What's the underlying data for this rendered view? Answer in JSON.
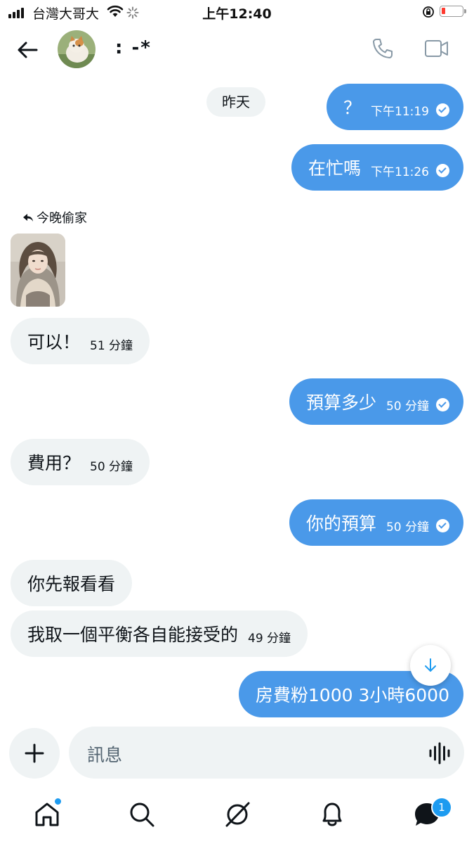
{
  "status_bar": {
    "carrier": "台灣大哥大",
    "time": "上午12:40"
  },
  "header": {
    "contact_name": ": -*",
    "icons": [
      "back-arrow-icon",
      "phone-icon",
      "video-icon"
    ]
  },
  "chat": {
    "day_separator": "昨天",
    "reply_label": "今晚偷家",
    "messages": [
      {
        "dir": "out",
        "text": "？",
        "time": "下午11:19"
      },
      {
        "dir": "out",
        "text": "在忙嗎",
        "time": "下午11:26"
      },
      {
        "dir": "in",
        "text": "可以！",
        "time": "51 分鐘"
      },
      {
        "dir": "out",
        "text": "預算多少",
        "time": "50 分鐘"
      },
      {
        "dir": "in",
        "text": "費用？",
        "time": "50 分鐘"
      },
      {
        "dir": "out",
        "text": "你的預算",
        "time": "50 分鐘"
      },
      {
        "dir": "in",
        "text": "你先報看看",
        "time": ""
      },
      {
        "dir": "in",
        "text": "我取一個平衡各自能接受的",
        "time": "49 分鐘"
      },
      {
        "dir": "out",
        "text": "房費粉1000 3小時6000",
        "time": ""
      }
    ]
  },
  "composer": {
    "placeholder": "訊息"
  },
  "tabbar": {
    "items": [
      "home-icon",
      "search-icon",
      "grok-icon",
      "notifications-icon",
      "messages-icon"
    ],
    "messages_badge": "1"
  },
  "colors": {
    "outgoing_bubble": "#4a99e9",
    "incoming_bubble": "#eff3f4",
    "accent": "#1d9bf0"
  }
}
